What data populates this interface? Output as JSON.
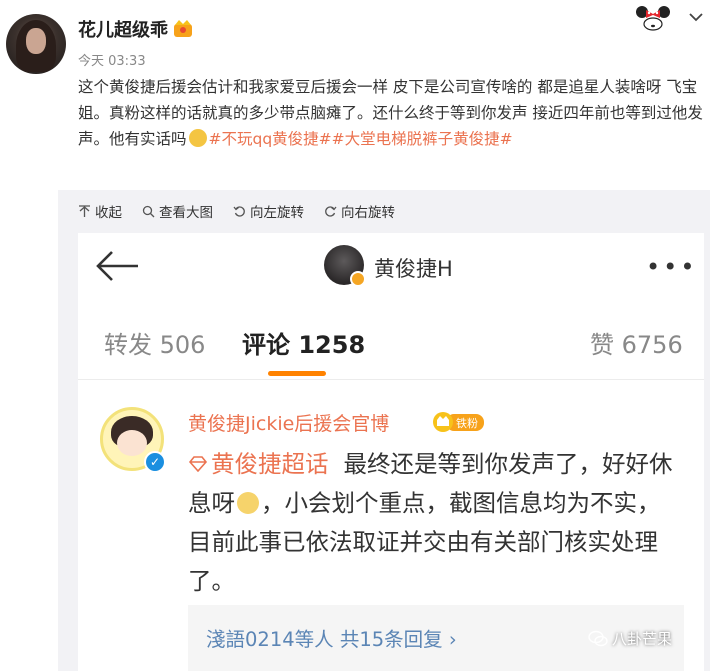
{
  "post": {
    "username": "花儿超级乖",
    "time": "今天 03:33",
    "body_text": "这个黄俊捷后援会估计和我家爱豆后援会一样 皮下是公司宣传啥的 都是追星人装啥呀 飞宝姐。真粉这样的话就真的多少带点脑瘫了。还什么终于等到你发声 接近四年前也等到过他发声。他有实话吗",
    "tag1": "#不玩qq黄俊捷#",
    "tag2": "#大堂电梯脱裤子黄俊捷#"
  },
  "toolbar": {
    "collapse": "收起",
    "view_large": "查看大图",
    "rotate_left": "向左旋转",
    "rotate_right": "向右旋转"
  },
  "screenshot": {
    "header_name": "黄俊捷H",
    "more": "•••",
    "tabs": [
      {
        "label": "转发",
        "count": "506"
      },
      {
        "label": "评论",
        "count": "1258"
      },
      {
        "label": "赞",
        "count": "6756"
      }
    ],
    "comment": {
      "author": "黄俊捷Jickie后援会官博",
      "fan_badge": "铁粉",
      "supertag": "黄俊捷超话",
      "text": "最终还是等到你发声了，好好休息呀",
      "text2": "，小会划个重点，截图信息均为不实，目前此事已依法取证并交由有关部门核实处理了。",
      "reply_summary": "淺語0214等人  共15条回复 ›"
    }
  },
  "watermark": "八卦芒果",
  "colors": {
    "accent_orange": "#ff8200",
    "tag_orange": "#eb7350",
    "link_blue": "#5b85b5"
  }
}
